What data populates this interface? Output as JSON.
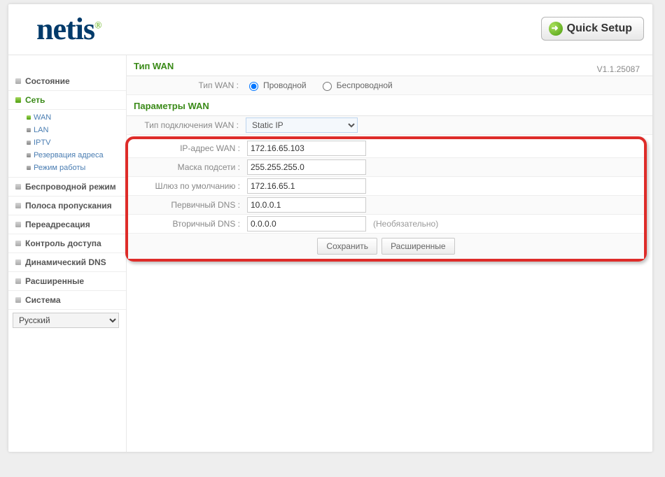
{
  "header": {
    "logo_text": "netis",
    "quick_setup": "Quick Setup",
    "version": "V1.1.25087"
  },
  "sidebar": {
    "items": [
      {
        "label": "Состояние",
        "active": false
      },
      {
        "label": "Сеть",
        "active": true
      },
      {
        "label": "Беспроводной режим",
        "active": false
      },
      {
        "label": "Полоса пропускания",
        "active": false
      },
      {
        "label": "Переадресация",
        "active": false
      },
      {
        "label": "Контроль доступа",
        "active": false
      },
      {
        "label": "Динамический DNS",
        "active": false
      },
      {
        "label": "Расширенные",
        "active": false
      },
      {
        "label": "Система",
        "active": false
      }
    ],
    "sub_items": [
      {
        "label": "WAN",
        "active": true
      },
      {
        "label": "LAN",
        "active": false
      },
      {
        "label": "IPTV",
        "active": false
      },
      {
        "label": "Резервация адреса",
        "active": false
      },
      {
        "label": "Режим работы",
        "active": false
      }
    ],
    "language": "Русский"
  },
  "main": {
    "wan_type_section": "Тип WAN",
    "wan_type_label": "Тип WAN :",
    "wan_type_wired": "Проводной",
    "wan_type_wireless": "Беспроводной",
    "wan_params_section": "Параметры WAN",
    "conn_type_label": "Тип подключения WAN :",
    "conn_type_value": "Static IP",
    "fields": {
      "ip_label": "IP-адрес WAN :",
      "ip_value": "172.16.65.103",
      "mask_label": "Маска подсети :",
      "mask_value": "255.255.255.0",
      "gw_label": "Шлюз по умолчанию :",
      "gw_value": "172.16.65.1",
      "dns1_label": "Первичный DNS :",
      "dns1_value": "10.0.0.1",
      "dns2_label": "Вторичный DNS :",
      "dns2_value": "0.0.0.0",
      "dns2_note": "(Необязательно)"
    },
    "btn_save": "Сохранить",
    "btn_advanced": "Расширенные"
  }
}
